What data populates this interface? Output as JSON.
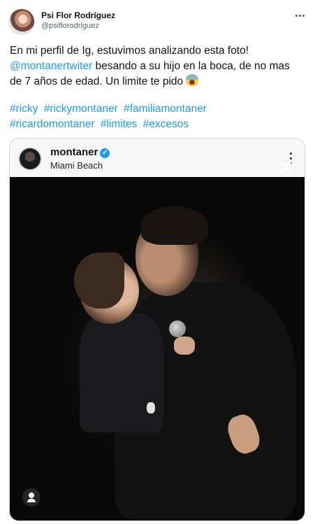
{
  "author": {
    "display_name": "Psi Flor Rodríguez",
    "handle": "@psiflorodriguez"
  },
  "tweet": {
    "line1": "En mi perfil de Ig, estuvimos analizando esta foto!",
    "mention": "@montanertwiter",
    "line2_rest": " besando a su hijo en la boca, de no mas de 7 años de edad. Un limite te pido ",
    "emoji": "screaming-face-emoji",
    "hashtags": [
      "#ricky",
      "#rickymontaner",
      "#familiamontaner",
      "#ricardomontaner",
      "#limites",
      "#excesos"
    ]
  },
  "embedded_post": {
    "account_name": "montaner",
    "location": "Miami Beach",
    "verified": true
  },
  "colors": {
    "link": "#1d9bf0",
    "text": "#0f1419",
    "secondary": "#536471"
  }
}
